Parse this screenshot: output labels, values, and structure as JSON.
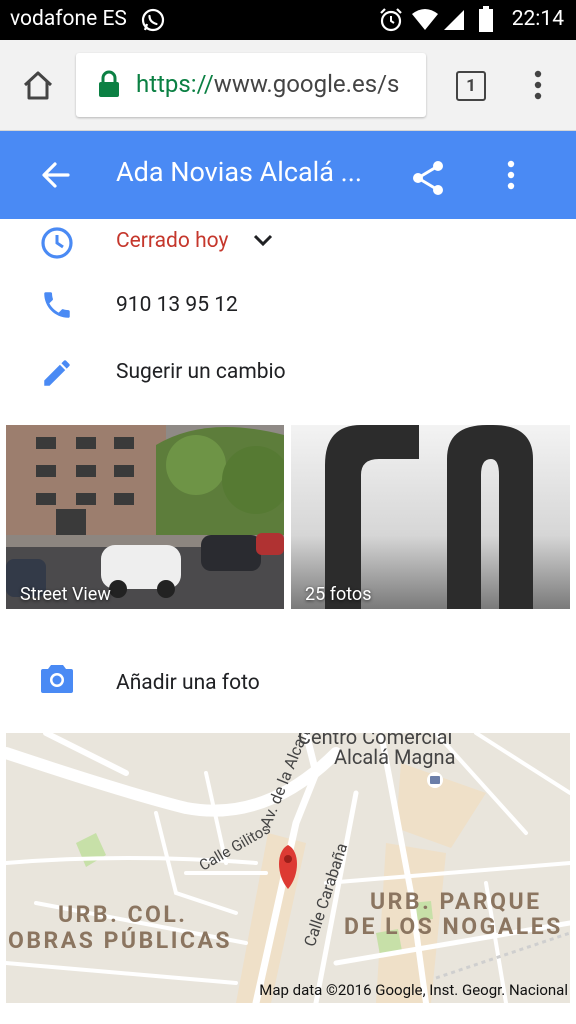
{
  "status_bar": {
    "carrier": "vodafone ES",
    "time": "22:14"
  },
  "browser": {
    "url_scheme": "https://",
    "url_rest": "www.google.es/s",
    "tab_count": "1"
  },
  "app_bar": {
    "title": "Ada Novias Alcalá ...",
    "accent_color": "#4a8af4"
  },
  "details": {
    "hours_status": "Cerrado hoy",
    "phone": "910 13 95 12",
    "suggest_edit": "Sugerir un cambio",
    "add_photo": "Añadir una foto"
  },
  "photos": {
    "street_view_label": "Street View",
    "photos_label": "25 fotos"
  },
  "map": {
    "label_centro": "Centro Comercial",
    "label_alcala_magna": "Alcalá Magna",
    "label_alcarria": "Av. de la Alcarria",
    "label_carabana": "Calle Carabaña",
    "label_gilitos": "Calle Gilitos",
    "label_urb_col": "URB. COL.",
    "label_obras": "OBRAS PÚBLICAS",
    "label_urb_parque": "URB. PARQUE",
    "label_nogales": "DE LOS NOGALES",
    "copyright": "Map data ©2016 Google, Inst. Geogr. Nacional"
  }
}
